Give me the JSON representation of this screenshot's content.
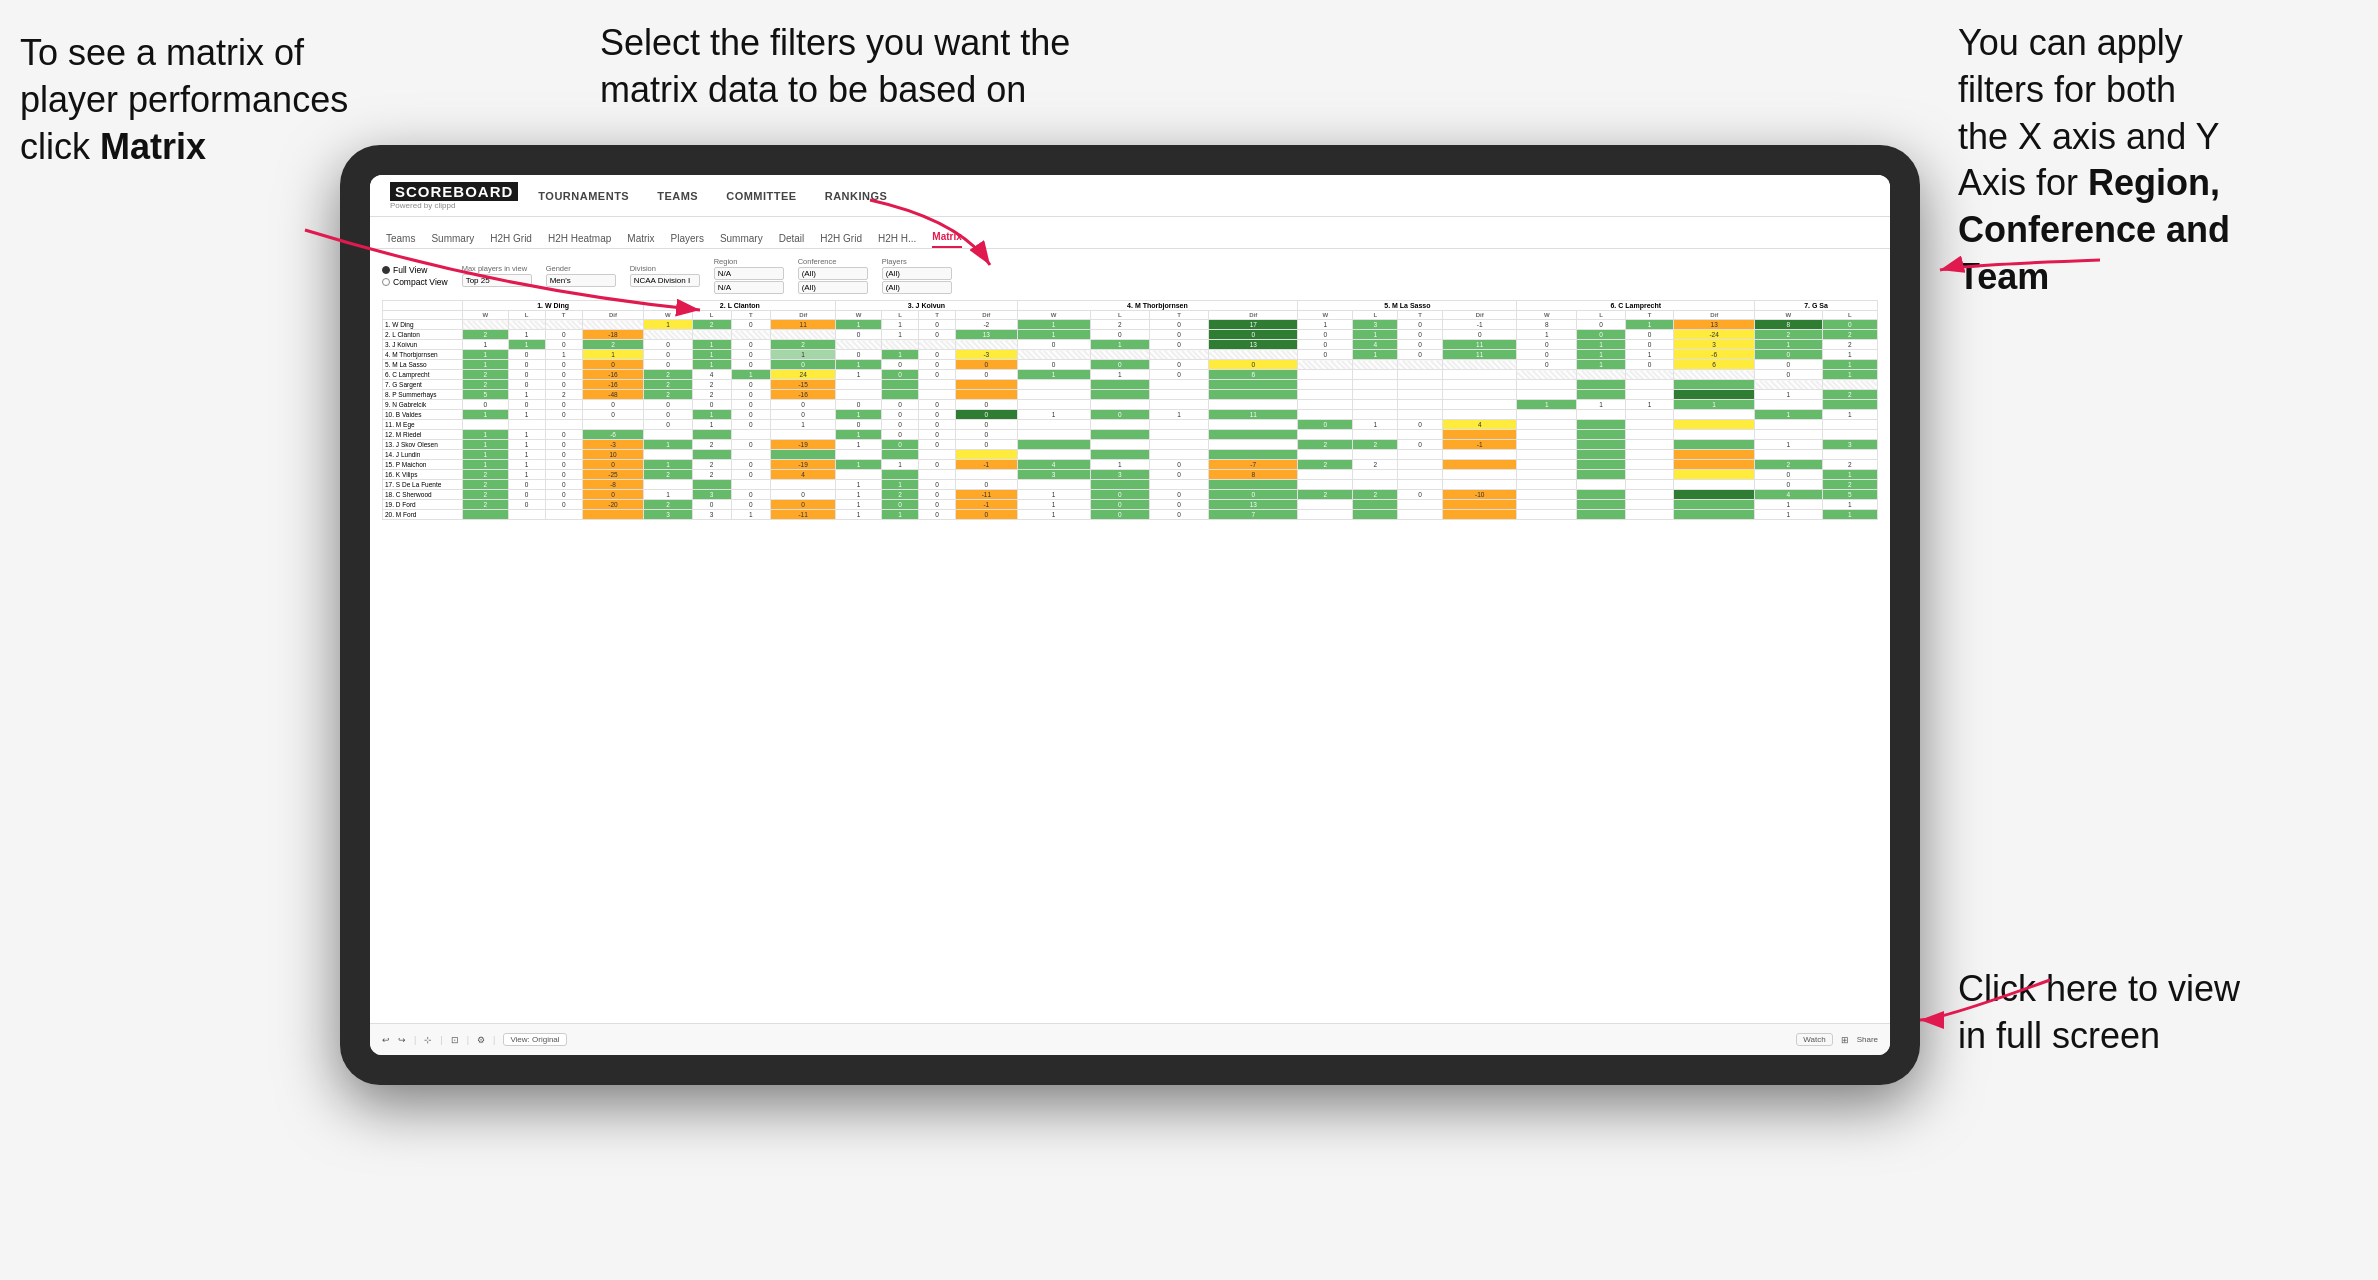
{
  "annotations": {
    "top_left": {
      "line1": "To see a matrix of",
      "line2": "player performances",
      "line3_prefix": "click ",
      "line3_bold": "Matrix"
    },
    "top_center": {
      "text": "Select the filters you want the matrix data to be based on"
    },
    "top_right": {
      "line1": "You  can apply",
      "line2": "filters for both",
      "line3": "the X axis and Y",
      "line4_prefix": "Axis for ",
      "line4_bold": "Region,",
      "line5_bold": "Conference and",
      "line6_bold": "Team"
    },
    "bottom_right": {
      "line1": "Click here to view",
      "line2": "in full screen"
    }
  },
  "app": {
    "logo_main": "SCOREBOARD",
    "logo_sub": "Powered by clippd",
    "nav_items": [
      "TOURNAMENTS",
      "TEAMS",
      "COMMITTEE",
      "RANKINGS"
    ]
  },
  "sub_tabs": [
    "Teams",
    "Summary",
    "H2H Grid",
    "H2H Heatmap",
    "Matrix",
    "Players",
    "Summary",
    "Detail",
    "H2H Grid",
    "H2H H...",
    "Matrix"
  ],
  "filters": {
    "view_full": "Full View",
    "view_compact": "Compact View",
    "max_players_label": "Max players in view",
    "max_players_value": "Top 25",
    "gender_label": "Gender",
    "gender_value": "Men's",
    "division_label": "Division",
    "division_value": "NCAA Division I",
    "region_label": "Region",
    "region_value1": "N/A",
    "region_value2": "N/A",
    "conference_label": "Conference",
    "conference_value1": "(All)",
    "conference_value2": "(All)",
    "players_label": "Players",
    "players_value1": "(All)",
    "players_value2": "(All)"
  },
  "column_headers": [
    "1. W Ding",
    "2. L Clanton",
    "3. J Koivun",
    "4. M Thorbjornsen",
    "5. M La Sasso",
    "6. C Lamprecht",
    "7. G Sa"
  ],
  "sub_headers": [
    "W",
    "L",
    "T",
    "Dif"
  ],
  "row_players": [
    "1. W Ding",
    "2. L Clanton",
    "3. J Koivun",
    "4. M Thorbjornsen",
    "5. M La Sasso",
    "6. C Lamprecht",
    "7. G Sargent",
    "8. P Summerhays",
    "9. N Gabrelcik",
    "10. B Valdes",
    "11. M Ege",
    "12. M Riedel",
    "13. J Skov Olesen",
    "14. J Lundin",
    "15. P Maichon",
    "16. K Vilips",
    "17. S De La Fuente",
    "18. C Sherwood",
    "19. D Ford",
    "20. M Ford"
  ],
  "bottom_bar": {
    "view_label": "View: Original",
    "watch_label": "Watch",
    "share_label": "Share"
  }
}
